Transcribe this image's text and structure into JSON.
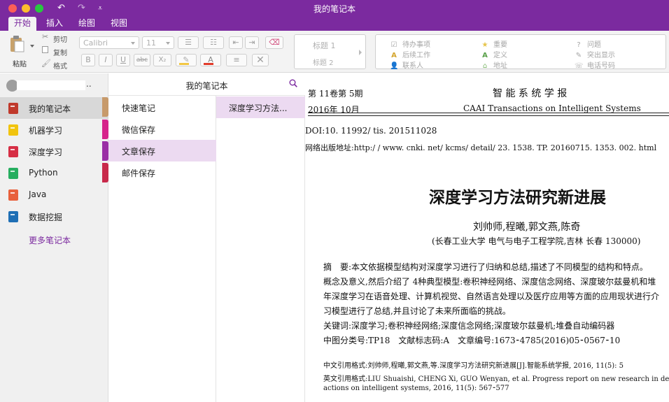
{
  "window": {
    "title": "我的笔记本"
  },
  "titlebar": {
    "undo_glyph": "↶",
    "redo_glyph": "↷",
    "menu_glyph": "⩡"
  },
  "tabs": [
    {
      "label": "开始"
    },
    {
      "label": "插入"
    },
    {
      "label": "绘图"
    },
    {
      "label": "视图"
    }
  ],
  "ribbon": {
    "paste_label": "粘贴",
    "cut_label": "剪切",
    "copy_label": "复制",
    "format_label": "格式",
    "font_name": "Calibri",
    "font_size": "11",
    "bold": "B",
    "italic": "I",
    "underline": "U",
    "strike": "abc",
    "subscript": "X₂",
    "styles": {
      "heading1": "标题 1",
      "heading2": "标题 2"
    },
    "tags": {
      "todo": "待办事项",
      "important": "重要",
      "question": "问题",
      "followup": "后续工作",
      "definition": "定义",
      "highlight": "突出显示",
      "contact": "联系人",
      "address": "地址",
      "phone": "电话号码"
    },
    "colors": {
      "accent": "#7b2a9f",
      "highlight": "#f2c744",
      "font_color": "#e13c2b"
    }
  },
  "sidebar": {
    "notebooks": [
      {
        "label": "我的笔记本",
        "color": "#c0392b"
      },
      {
        "label": "机器学习",
        "color": "#f1c40f"
      },
      {
        "label": "深度学习",
        "color": "#d62f45"
      },
      {
        "label": "Python",
        "color": "#27ae60"
      },
      {
        "label": "Java",
        "color": "#e8603c"
      },
      {
        "label": "数据挖掘",
        "color": "#1f6fb5"
      }
    ],
    "more_label": "更多笔记本",
    "stripe_colors": [
      "#c79a6a",
      "#d6238b",
      "#9a2fa5",
      "#c8294a"
    ]
  },
  "notebook_header": {
    "title": "我的笔记本"
  },
  "sections": [
    {
      "label": "快速笔记"
    },
    {
      "label": "微信保存"
    },
    {
      "label": "文章保存"
    },
    {
      "label": "邮件保存"
    }
  ],
  "pages": [
    {
      "label": "深度学习方法..."
    }
  ],
  "document": {
    "journal_vol": "第 11卷第 5期",
    "journal_name": "智 能 系 统 学 报",
    "journal_date": "2016年 10月",
    "journal_en": "CAAI Transactions on Intelligent Systems",
    "doi": "DOI:10. 11992/ tis. 201511028",
    "url": "网络出版地址:http:/ / www. cnki. net/ kcms/ detail/ 23. 1538. TP. 20160715. 1353. 002. html",
    "title": "深度学习方法研究新进展",
    "authors": "刘帅师,程曦,郭文燕,陈奇",
    "affiliation": "(长春工业大学 电气与电子工程学院,吉林 长春 130000)",
    "abstract_lines": [
      "摘　要:本文依据模型结构对深度学习进行了归纳和总结,描述了不同模型的结构和特点。",
      "概念及意义,然后介绍了 4种典型模型:卷积神经网络、深度信念网络、深度玻尔兹曼机和堆",
      "年深度学习在语音处理、计算机视觉、自然语言处理以及医疗应用等方面的应用现状进行介",
      "习模型进行了总结,并且讨论了未来所面临的挑战。"
    ],
    "keywords": "关键词:深度学习;卷积神经网络;深度信念网络;深度玻尔兹曼机;堆叠自动编码器",
    "classification": "中图分类号:TP18　文献标志码:A　文章编号:1673⁃4785(2016)05⁃0567⁃10",
    "cite_cn": "中文引用格式:刘帅师,程曦,郭文燕,等.深度学习方法研究新进展[J].智能系统学报, 2016, 11(5): 5",
    "cite_en1": "英文引用格式:LIU Shuaishi, CHENG Xi, GUO Wenyan, et al. Progress report on new research in dee",
    "cite_en2": "actions on intelligent systems, 2016, 11(5): 567⁃577"
  }
}
